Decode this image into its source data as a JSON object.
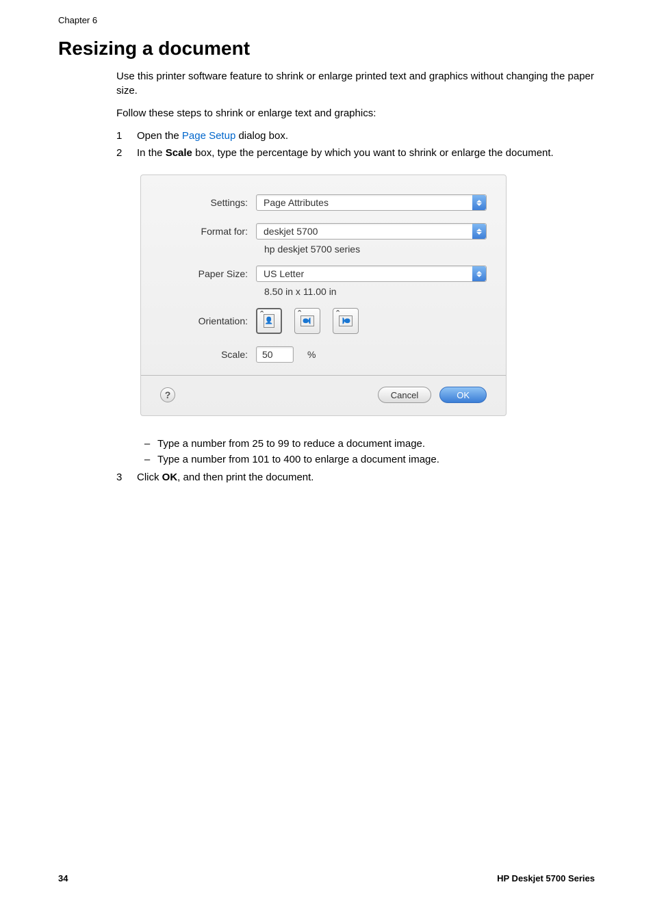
{
  "chapter": "Chapter 6",
  "title": "Resizing a document",
  "intro1": "Use this printer software feature to shrink or enlarge printed text and graphics without changing the paper size.",
  "intro2": "Follow these steps to shrink or enlarge text and graphics:",
  "steps": {
    "s1": {
      "num": "1",
      "pre": "Open the ",
      "link": "Page Setup",
      "post": " dialog box."
    },
    "s2": {
      "num": "2",
      "pre": "In the ",
      "bold": "Scale",
      "post": " box, type the percentage by which you want to shrink or enlarge the document."
    },
    "sub1": "Type a number from 25 to 99 to reduce a document image.",
    "sub2": "Type a number from 101 to 400 to enlarge a document image.",
    "s3": {
      "num": "3",
      "pre": "Click ",
      "bold": "OK",
      "post": ", and then print the document."
    }
  },
  "dialog": {
    "settings_label": "Settings:",
    "settings_value": "Page Attributes",
    "format_label": "Format for:",
    "format_value": "deskjet 5700",
    "format_sub": "hp deskjet 5700 series",
    "paper_label": "Paper Size:",
    "paper_value": "US Letter",
    "paper_sub": "8.50 in x 11.00 in",
    "orientation_label": "Orientation:",
    "scale_label": "Scale:",
    "scale_value": "50",
    "scale_unit": "%",
    "help": "?",
    "cancel": "Cancel",
    "ok": "OK"
  },
  "footer": {
    "page": "34",
    "product": "HP Deskjet 5700 Series"
  }
}
